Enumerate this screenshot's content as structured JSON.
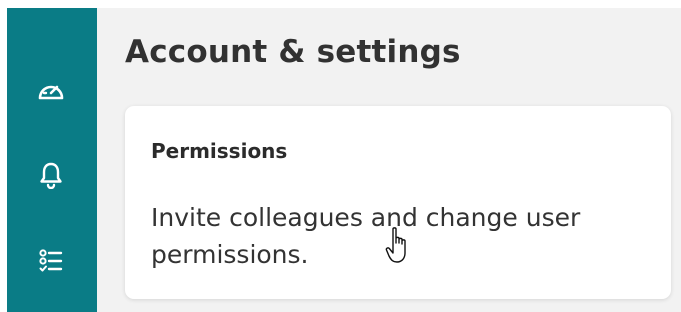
{
  "sidebar": {
    "background": "#0a7c86",
    "icons": [
      {
        "name": "speedometer-icon"
      },
      {
        "name": "bell-icon"
      },
      {
        "name": "checklist-icon"
      }
    ]
  },
  "page": {
    "title": "Account & settings"
  },
  "card": {
    "title": "Permissions",
    "description": "Invite colleagues and change user permissions."
  },
  "cursor": {
    "type": "hand-pointer"
  }
}
